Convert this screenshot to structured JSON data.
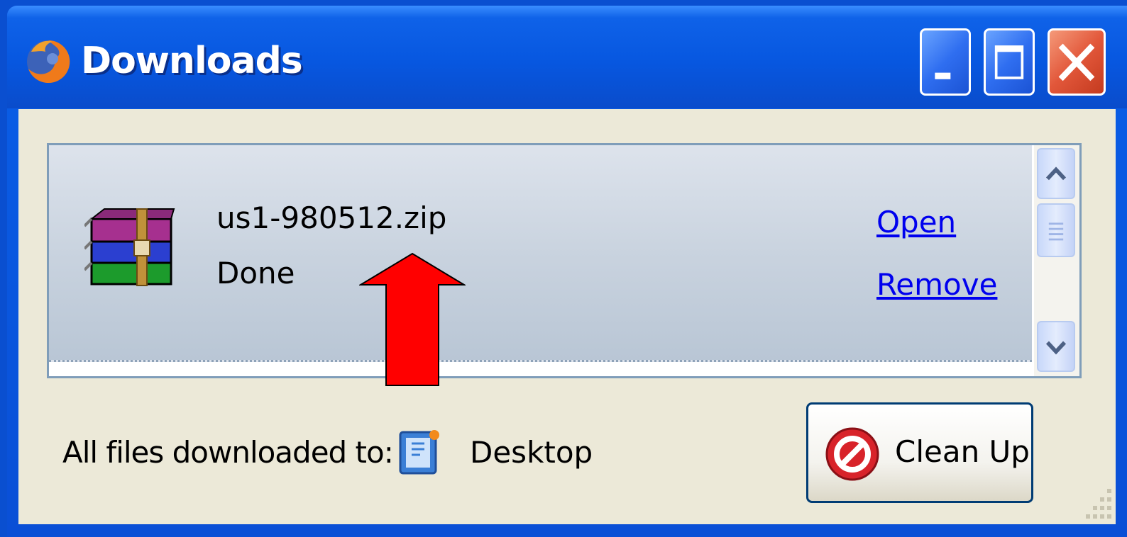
{
  "window": {
    "title": "Downloads"
  },
  "download_item": {
    "file_name": "us1-980512.zip",
    "status": "Done",
    "actions": {
      "open_label": "Open",
      "remove_label": "Remove"
    }
  },
  "footer": {
    "destination_label": "All files downloaded to:",
    "destination_folder": "Desktop",
    "cleanup_label": "Clean Up"
  },
  "icons": {
    "app": "firefox-icon",
    "file": "winrar-archive-icon",
    "folder": "desktop-folder-icon",
    "cleanup": "cleanup-stop-icon",
    "annotation": "red-up-arrow"
  },
  "colors": {
    "titlebar": "#0a4fd6",
    "link": "#0000ee",
    "annotation_arrow": "#ff0000",
    "close_button": "#e2573a"
  }
}
